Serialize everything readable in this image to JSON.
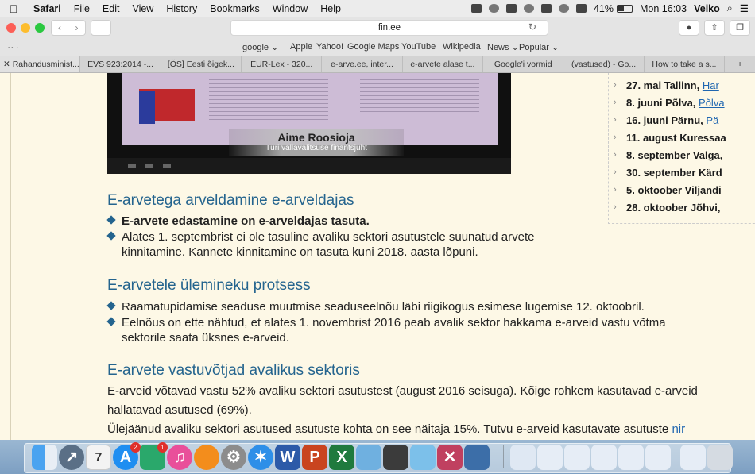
{
  "menubar": {
    "apple": "",
    "app": "Safari",
    "items": [
      "File",
      "Edit",
      "View",
      "History",
      "Bookmarks",
      "Window",
      "Help"
    ],
    "battery": "41%",
    "clock": "Mon 16:03",
    "user": "Veiko"
  },
  "toolbar": {
    "url": "fin.ee"
  },
  "favorites": [
    "google ⌄",
    "Apple",
    "Yahoo!",
    "Google Maps",
    "YouTube",
    "Wikipedia",
    "News ⌄",
    "Popular ⌄"
  ],
  "tabs": [
    "Rahandusminist...",
    "EVS 923:2014 -...",
    "[ÕS] Eesti õigek...",
    "EUR-Lex - 320...",
    "e-arve.ee, inter...",
    "e-arvete alase t...",
    "Google'i vormid",
    "(vastused) - Go...",
    "How to take a s...",
    "+"
  ],
  "video": {
    "speaker_name": "Aime Roosioja",
    "speaker_role": "Türi vallavalitsuse finantsjuht"
  },
  "events": [
    {
      "text": "27. mai Tallinn, ",
      "link": "Har"
    },
    {
      "text": "8. juuni Põlva, ",
      "link": "Põlva"
    },
    {
      "text": "16. juuni Pärnu, ",
      "link": "Pä"
    },
    {
      "text": "11. august Kuressaa",
      "link": ""
    },
    {
      "text": "8. september Valga,",
      "link": ""
    },
    {
      "text": "30. september Kärd",
      "link": ""
    },
    {
      "text": "5. oktoober Viljandi",
      "link": ""
    },
    {
      "text": "28. oktoober Jõhvi,",
      "link": ""
    }
  ],
  "sections": {
    "s1": {
      "title": "E-arvetega arveldamine e-arveldajas",
      "b1": "E-arvete edastamine on e-arveldajas tasuta.",
      "b2_line1": "Alates 1. septembrist ei ole tasuline avaliku sektori asutustele suunatud arvete",
      "b2_line2": "kinnitamine. Kannete kinnitamine on tasuta kuni 2018. aasta lõpuni."
    },
    "s2": {
      "title": "E-arvetele ülemineku protsess",
      "b1": "Raamatupidamise seaduse muutmise seaduseelnõu läbi riigikogus esimese lugemise 12. oktoobril.",
      "b2_line1": "Eelnõus on ette nähtud, et alates 1. novembrist 2016 peab avalik sektor hakkama e-arveid vastu võtma",
      "b2_line2": "sektorile saata üksnes e-arveid."
    },
    "s3": {
      "title": "E-arvete vastuvõtjad avalikus sektoris",
      "p1_line1": "E-arveid võtavad vastu 52% avaliku sektori asutustest (august 2016 seisuga). Kõige rohkem kasutavad e-arveid",
      "p1_line2": "hallatavad asutused (69%).",
      "p2": "Ülejäänud avaliku sektori asutused asutuste kohta on see näitaja 15%. Tutvu e-arveid kasutavate asutuste ",
      "p2_link": "nir"
    }
  },
  "dock": {
    "calendar_day": "7",
    "appstore_badge": "2",
    "contacts_badge": "1"
  }
}
